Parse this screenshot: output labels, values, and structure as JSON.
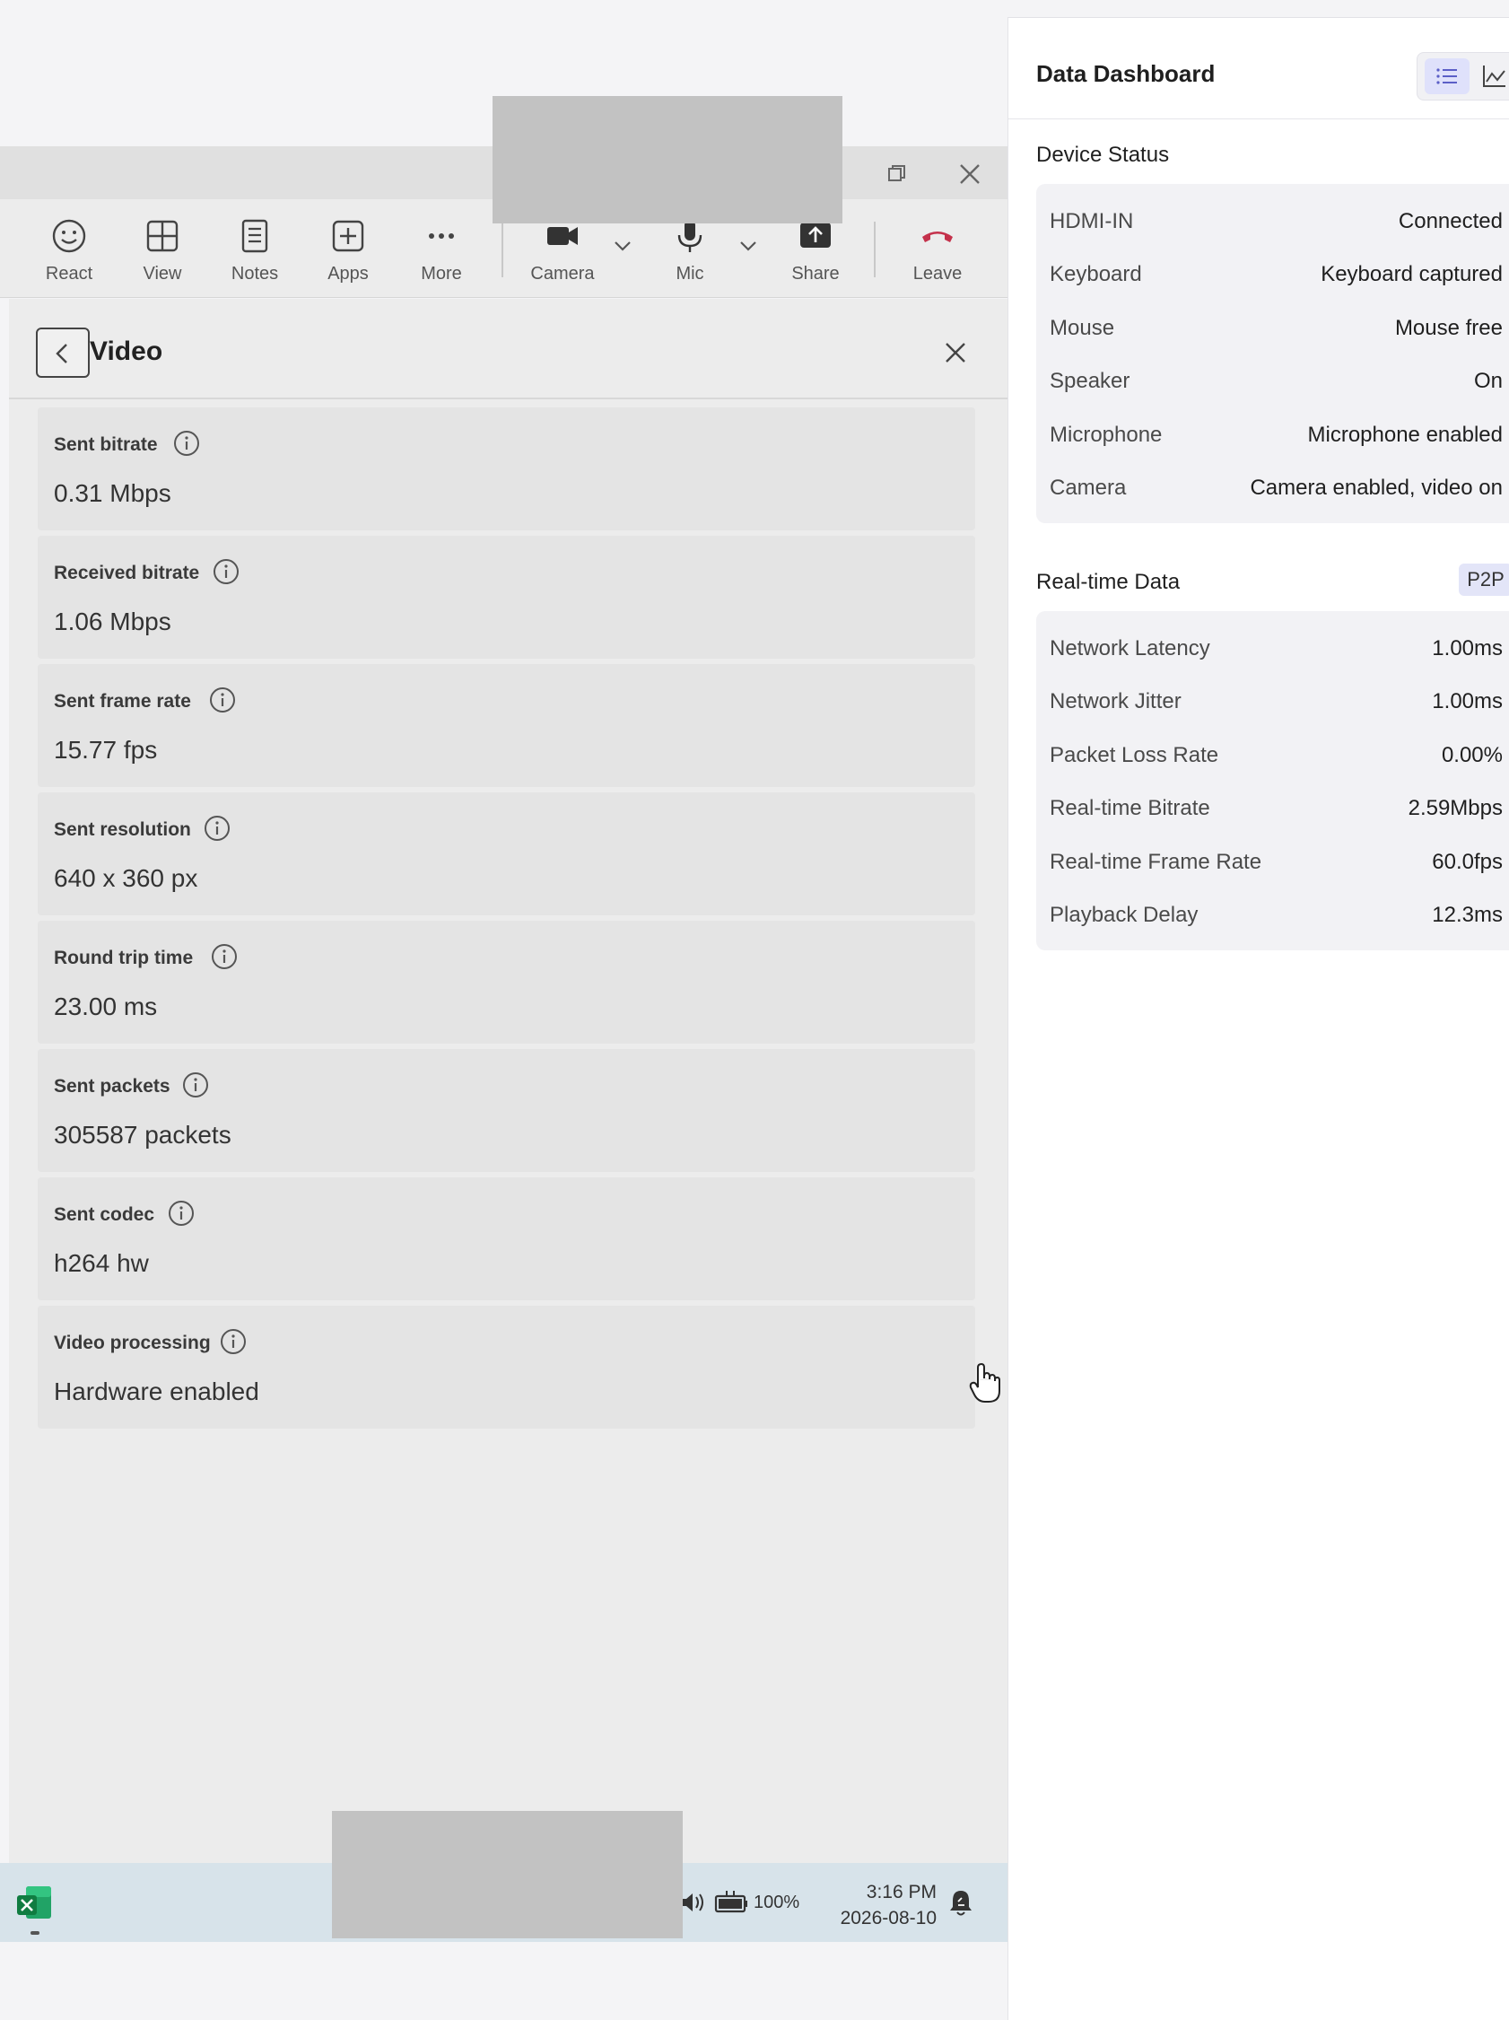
{
  "toolbar": {
    "react": "React",
    "view": "View",
    "notes": "Notes",
    "apps": "Apps",
    "more": "More",
    "camera": "Camera",
    "mic": "Mic",
    "share": "Share",
    "leave": "Leave"
  },
  "panel": {
    "title": "Video",
    "stats": [
      {
        "name": "Sent bitrate",
        "value": "0.31 Mbps"
      },
      {
        "name": "Received bitrate",
        "value": "1.06 Mbps"
      },
      {
        "name": "Sent frame rate",
        "value": "15.77 fps"
      },
      {
        "name": "Sent resolution",
        "value": "640 x 360 px"
      },
      {
        "name": "Round trip time",
        "value": "23.00 ms"
      },
      {
        "name": "Sent packets",
        "value": "305587 packets"
      },
      {
        "name": "Sent codec",
        "value": "h264 hw"
      },
      {
        "name": "Video processing",
        "value": "Hardware enabled"
      }
    ]
  },
  "taskbar": {
    "battery": "100%",
    "time": "3:16 PM",
    "date": "2026-08-10",
    "app_icon": "excel-icon"
  },
  "dashboard": {
    "title": "Data Dashboard",
    "device_status": {
      "title": "Device Status",
      "rows": [
        {
          "key": "HDMI-IN",
          "value": "Connected"
        },
        {
          "key": "Keyboard",
          "value": "Keyboard captured"
        },
        {
          "key": "Mouse",
          "value": "Mouse free"
        },
        {
          "key": "Speaker",
          "value": "On"
        },
        {
          "key": "Microphone",
          "value": "Microphone enabled"
        },
        {
          "key": "Camera",
          "value": "Camera enabled, video on"
        }
      ]
    },
    "realtime": {
      "title": "Real-time Data",
      "badge": "P2P",
      "rows": [
        {
          "key": "Network Latency",
          "value": "1.00ms"
        },
        {
          "key": "Network Jitter",
          "value": "1.00ms"
        },
        {
          "key": "Packet Loss Rate",
          "value": "0.00%"
        },
        {
          "key": "Real-time Bitrate",
          "value": "2.59Mbps"
        },
        {
          "key": "Real-time Frame Rate",
          "value": "60.0fps"
        },
        {
          "key": "Playback Delay",
          "value": "12.3ms"
        }
      ]
    }
  },
  "colors": {
    "leave_red": "#c4314b",
    "accent": "#5b5fc7",
    "excel_green": "#1d8a4a"
  }
}
